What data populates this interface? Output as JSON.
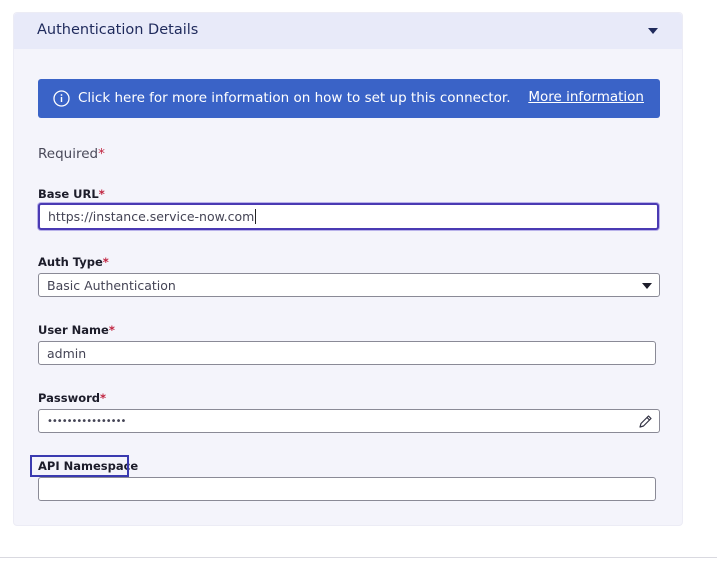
{
  "section": {
    "title": "Authentication Details"
  },
  "banner": {
    "text": "Click here for more information on how to set up this connector.",
    "link_label": "More information"
  },
  "form": {
    "required_note": "Required",
    "asterisk": "*",
    "fields": {
      "base_url": {
        "label": "Base URL",
        "value": "https://instance.service-now.com",
        "required": true
      },
      "auth_type": {
        "label": "Auth Type",
        "value": "Basic Authentication",
        "required": true
      },
      "user_name": {
        "label": "User Name",
        "value": "admin",
        "required": true
      },
      "password": {
        "label": "Password",
        "value": "••••••••••••••••",
        "required": true
      },
      "api_namespace": {
        "label": "API Namespace",
        "value": "",
        "required": false
      }
    }
  },
  "colors": {
    "accent": "#3a63c7",
    "focus": "#4a3ab3",
    "required": "#c0233f",
    "panel_bg": "#f4f4fb",
    "header_bg": "#e8eaf9"
  },
  "icons": {
    "collapse": "caret-down-icon",
    "info": "info-icon",
    "select": "chevron-down-icon",
    "edit": "pencil-icon"
  }
}
